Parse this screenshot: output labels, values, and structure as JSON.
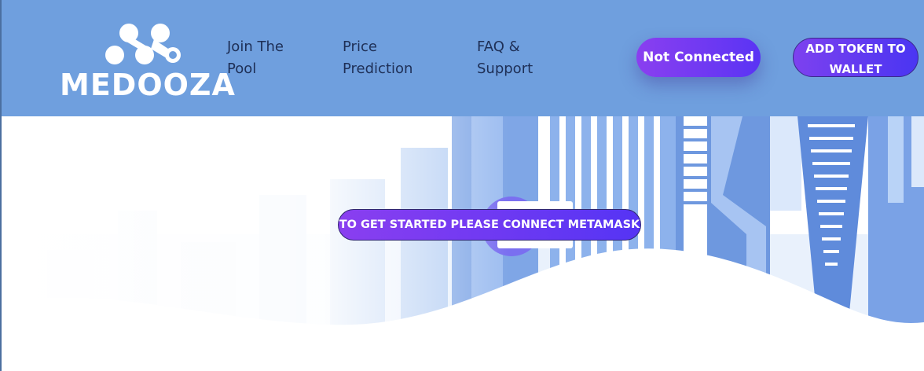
{
  "brand": {
    "name": "MEDOOZA",
    "logo_icon": "molecule-dots-icon"
  },
  "nav": {
    "items": [
      {
        "label": "Join The Pool"
      },
      {
        "label": "Price Prediction"
      },
      {
        "label": "FAQ & Support"
      }
    ]
  },
  "header": {
    "status_label": "Not Connected",
    "add_token_label": "ADD TOKEN TO WALLET"
  },
  "hero": {
    "cta_label": "TO GET STARTED PLEASE CONNECT METAMASK"
  },
  "colors": {
    "header_bg": "#6f9fde",
    "button_gradient_start": "#8a3ff0",
    "button_gradient_end": "#4a35f2",
    "nav_text": "#1e2f56"
  }
}
